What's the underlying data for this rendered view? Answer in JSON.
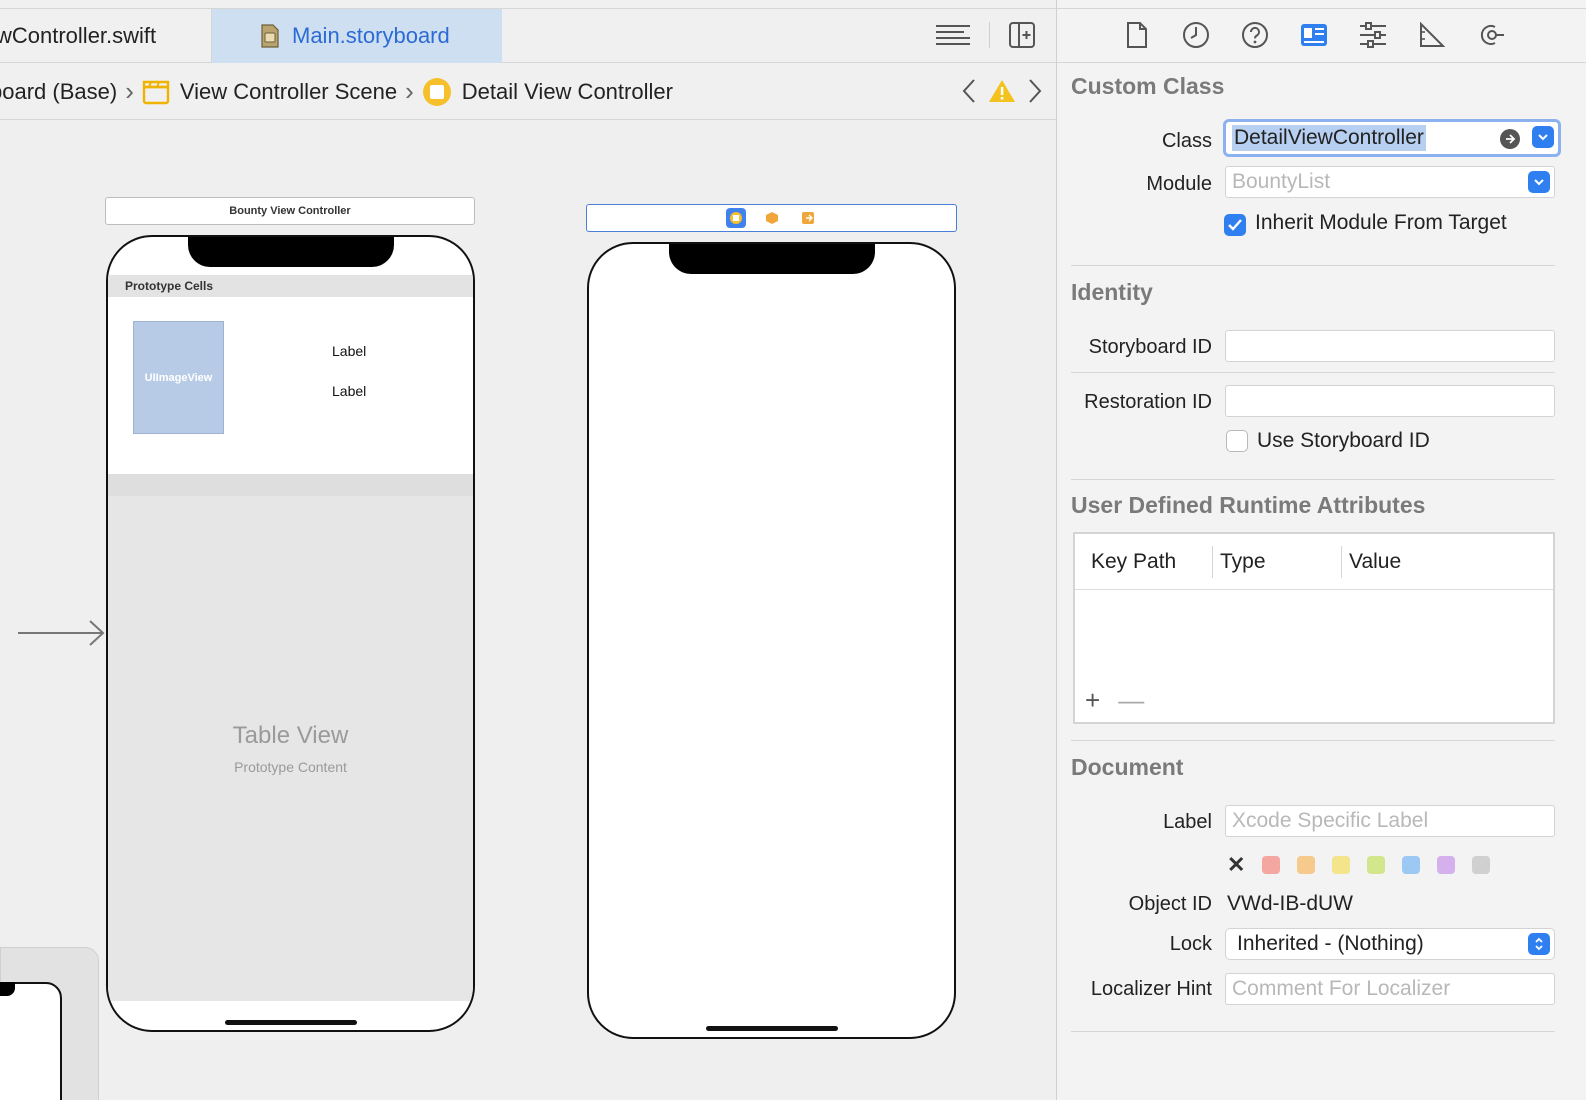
{
  "tabs": [
    {
      "label": "wController.swift"
    },
    {
      "label": "Main.storyboard"
    }
  ],
  "breadcrumb": [
    "board (Base)",
    "View Controller Scene",
    "Detail View Controller"
  ],
  "canvas": {
    "scene1_title": "Bounty View Controller",
    "prototype_cells": "Prototype Cells",
    "image_view": "UIImageView",
    "label1": "Label",
    "label2": "Label",
    "table_view": "Table View",
    "prototype_content": "Prototype Content"
  },
  "inspector": {
    "icons": [
      "file-icon",
      "history-icon",
      "help-icon",
      "identity-icon",
      "attributes-icon",
      "size-icon",
      "connections-icon"
    ],
    "custom_class": {
      "title": "Custom Class",
      "class_label": "Class",
      "class_value": "DetailViewController",
      "module_label": "Module",
      "module_placeholder": "BountyList",
      "inherit_label": "Inherit Module From Target",
      "inherit_checked": true
    },
    "identity": {
      "title": "Identity",
      "storyboard_id_label": "Storyboard ID",
      "storyboard_id_value": "",
      "restoration_id_label": "Restoration ID",
      "restoration_id_value": "",
      "use_storyboard_id_label": "Use Storyboard ID",
      "use_storyboard_id_checked": false
    },
    "runtime_attributes": {
      "title": "User Defined Runtime Attributes",
      "columns": [
        "Key Path",
        "Type",
        "Value"
      ],
      "add": "+",
      "remove": "—"
    },
    "document": {
      "title": "Document",
      "label_label": "Label",
      "label_placeholder": "Xcode Specific Label",
      "swatch_colors": [
        "#f4a6a0",
        "#f6c98c",
        "#f4e48c",
        "#d2e68c",
        "#9cc8f4",
        "#d4b0ec",
        "#d0d0d0"
      ],
      "object_id_label": "Object ID",
      "object_id_value": "VWd-IB-dUW",
      "lock_label": "Lock",
      "lock_value": "Inherited - (Nothing)",
      "localizer_label": "Localizer Hint",
      "localizer_placeholder": "Comment For Localizer"
    }
  },
  "colors": {
    "accent": "#2f7ff0",
    "tab_active_bg": "#cfdff2",
    "tab_active_text": "#2c6bd4",
    "section_title": "#7a7a7a"
  }
}
